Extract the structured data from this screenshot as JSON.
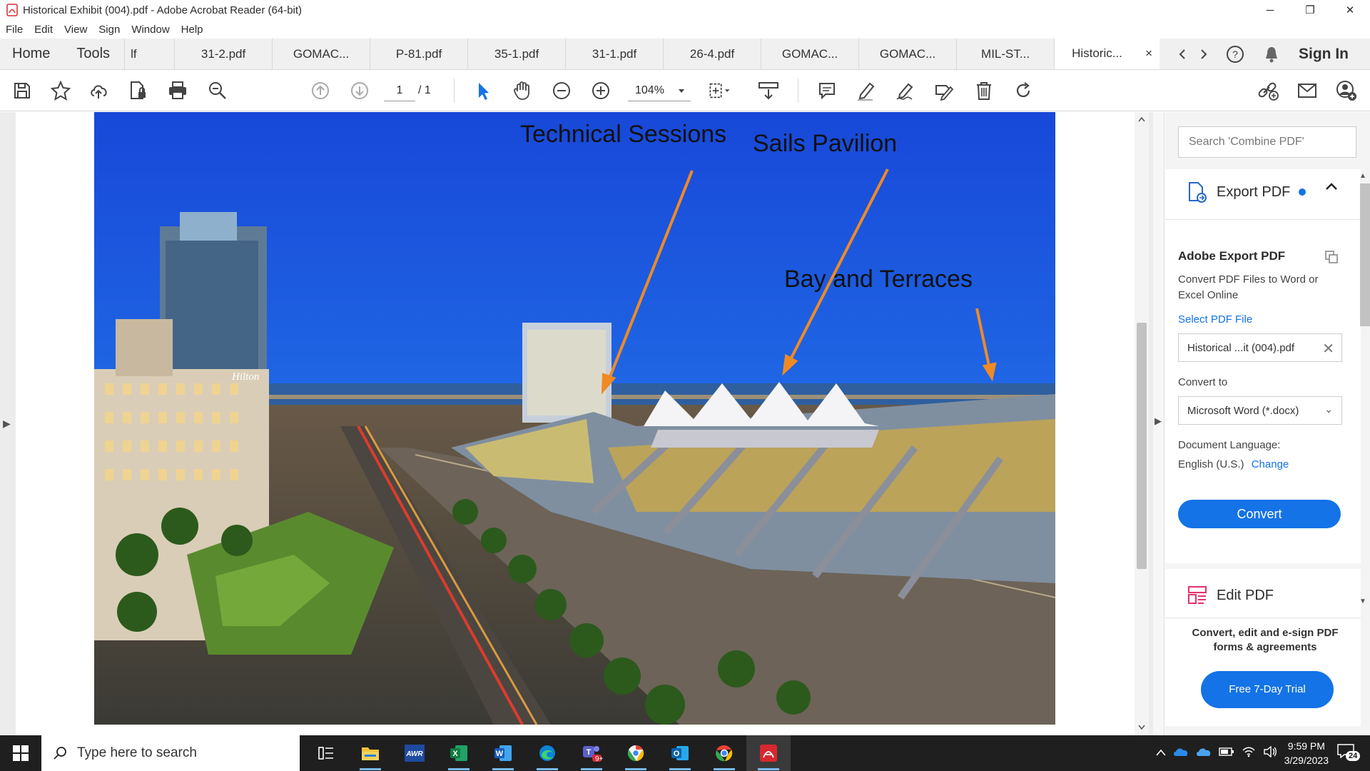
{
  "window": {
    "title": "Historical Exhibit (004).pdf - Adobe Acrobat Reader (64-bit)",
    "minimize": "─",
    "restore": "❐",
    "close": "✕"
  },
  "menu": [
    "File",
    "Edit",
    "View",
    "Sign",
    "Window",
    "Help"
  ],
  "tabs": {
    "home": "Home",
    "tools": "Tools",
    "partial": "lf",
    "docs": [
      "31-2.pdf",
      "GOMAC...",
      "P-81.pdf",
      "35-1.pdf",
      "31-1.pdf",
      "26-4.pdf",
      "GOMAC...",
      "GOMAC...",
      "MIL-ST..."
    ],
    "active": "Historic...",
    "active_close": "×",
    "sign_in": "Sign In"
  },
  "toolbar": {
    "page_current": "1",
    "page_total": "/ 1",
    "zoom": "104%"
  },
  "document": {
    "annotations": [
      "Technical Sessions",
      "Sails Pavilion",
      "Bay and Terraces"
    ],
    "photo_sign": "Hilton"
  },
  "panel": {
    "search_placeholder": "Search 'Combine PDF'",
    "export_title": "Export PDF",
    "adobe_export_title": "Adobe Export PDF",
    "adobe_export_desc": "Convert PDF Files to Word or Excel Online",
    "select_file": "Select PDF File",
    "file_name": "Historical ...it (004).pdf",
    "convert_to_label": "Convert to",
    "convert_to_value": "Microsoft Word (*.docx)",
    "doc_lang_label": "Document Language:",
    "doc_lang_value": "English (U.S.)",
    "change_link": "Change",
    "convert_button": "Convert",
    "edit_title": "Edit PDF",
    "promo_text": "Convert, edit and e-sign PDF forms & agreements",
    "trial_button": "Free 7-Day Trial"
  },
  "taskbar": {
    "search_text": "Type here to search",
    "apps": [
      "file-explorer",
      "awr",
      "excel",
      "word",
      "edge",
      "teams",
      "chrome-alt",
      "outlook",
      "chrome",
      "acrobat"
    ],
    "teams_badge": "9+",
    "time": "9:59 PM",
    "date": "3/29/2023",
    "notif_count": "24"
  },
  "colors": {
    "accent": "#1473e6",
    "arrow": "#f08a24",
    "sky_top": "#1a4fd6",
    "acrobat_red": "#d7282f"
  }
}
